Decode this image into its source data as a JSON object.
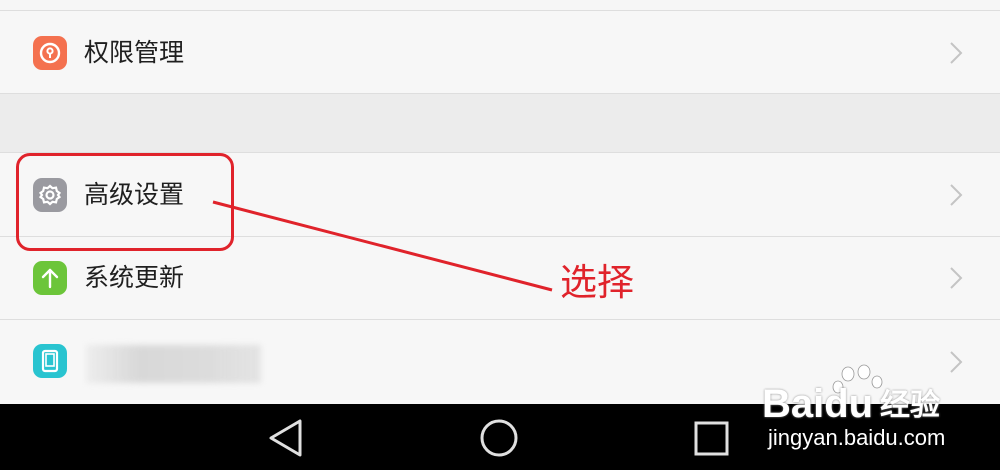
{
  "settings": {
    "items": [
      {
        "label": "权限管理",
        "icon": "permission-lock-icon",
        "color": "#f4714f"
      },
      {
        "label": "高级设置",
        "icon": "gear-icon",
        "color": "#9a9aa0"
      },
      {
        "label": "系统更新",
        "icon": "arrow-up-icon",
        "color": "#6cc53a"
      },
      {
        "label": "",
        "icon": "phone-device-icon",
        "color": "#29c4d0"
      }
    ]
  },
  "annotation": {
    "text": "选择",
    "color": "#e0232b"
  },
  "navbar": {
    "buttons": [
      "back-triangle-icon",
      "home-circle-icon",
      "recent-square-icon"
    ]
  },
  "watermark": {
    "logo": "Baidu",
    "logo_cn": "经验",
    "url": "jingyan.baidu.com"
  }
}
